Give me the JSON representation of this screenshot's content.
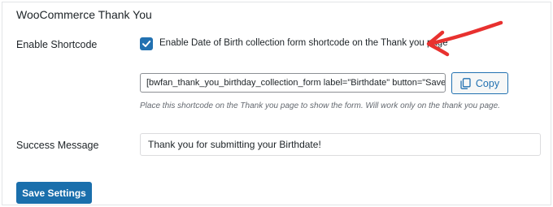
{
  "section": {
    "title": "WooCommerce Thank You"
  },
  "enable_shortcode": {
    "label": "Enable Shortcode",
    "checked": true,
    "checkbox_label": "Enable Date of Birth collection form shortcode on the Thank you page"
  },
  "shortcode": {
    "value": "[bwfan_thank_you_birthday_collection_form label=\"Birthdate\" button=\"Save\"]",
    "copy_label": "Copy",
    "help_text": "Place this shortcode on the Thank you page to show the form. Will work only on the thank you page."
  },
  "success_message": {
    "label": "Success Message",
    "value": "Thank you for submitting your Birthdate!"
  },
  "actions": {
    "save_label": "Save Settings"
  },
  "colors": {
    "accent": "#2271b1",
    "save_button": "#1a6fac",
    "annotation_arrow": "#e8312f"
  }
}
